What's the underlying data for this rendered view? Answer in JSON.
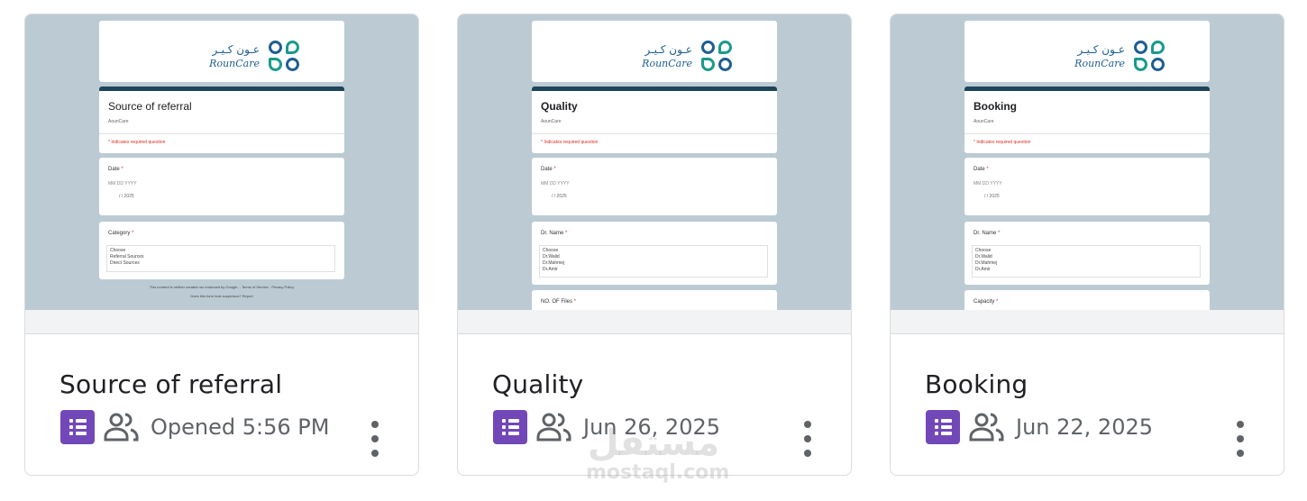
{
  "cards": [
    {
      "title": "Source of referral",
      "meta": "Opened 5:56 PM",
      "preview": {
        "logo_ar": "عـون كـيـر",
        "logo_en": "RounCare",
        "form_title": "Source of referral",
        "form_sub": "AounCare",
        "required_note": "* Indicates required question",
        "q1_label": "Date",
        "q1_date_fmt": "MM  DD  YYYY",
        "q1_date_val": "/   / 2025",
        "q2_label": "Category",
        "q2_options": [
          "Choose",
          "Referral Sources",
          "Direct Sources"
        ],
        "footer_line1": "This content is neither created nor endorsed by Google. - Terms of Service - Privacy Policy",
        "footer_line2": "Does this form look suspicious? Report"
      }
    },
    {
      "title": "Quality",
      "meta": "Jun 26, 2025",
      "preview": {
        "logo_ar": "عـون كـيـر",
        "logo_en": "RounCare",
        "form_title": "Quality",
        "form_sub": "AounCare",
        "required_note": "* Indicates required question",
        "q1_label": "Date",
        "q1_date_fmt": "MM  DD  YYYY",
        "q1_date_val": "/   / 2025",
        "q2_label": "Dr. Name",
        "q2_options": [
          "Choose",
          "Dr.Walid",
          "Dr.Mahmej",
          "Dr.Amir"
        ],
        "q3_label": "NO. OF Files"
      }
    },
    {
      "title": "Booking",
      "meta": "Jun 22, 2025",
      "preview": {
        "logo_ar": "عـون كـيـر",
        "logo_en": "RounCare",
        "form_title": "Booking",
        "form_sub": "AounCare",
        "required_note": "* Indicates required question",
        "q1_label": "Date",
        "q1_date_fmt": "MM  DD  YYYY",
        "q1_date_val": "/   / 2025",
        "q2_label": "Dr. Name",
        "q2_options": [
          "Choose",
          "Dr.Walid",
          "Dr.Mahmej",
          "Dr.Amir"
        ],
        "q3_label": "Capacity"
      }
    }
  ],
  "icons": {
    "file_type": "forms-icon",
    "shared": "people-icon",
    "more": "more-vert-icon"
  },
  "colors": {
    "forms_purple": "#7248b9",
    "thumb_bg": "#bccbd3",
    "form_header": "#1e4559",
    "meta_gray": "#5f6368"
  },
  "watermark": {
    "arabic": "مستقل",
    "latin": "mostaql.com"
  }
}
